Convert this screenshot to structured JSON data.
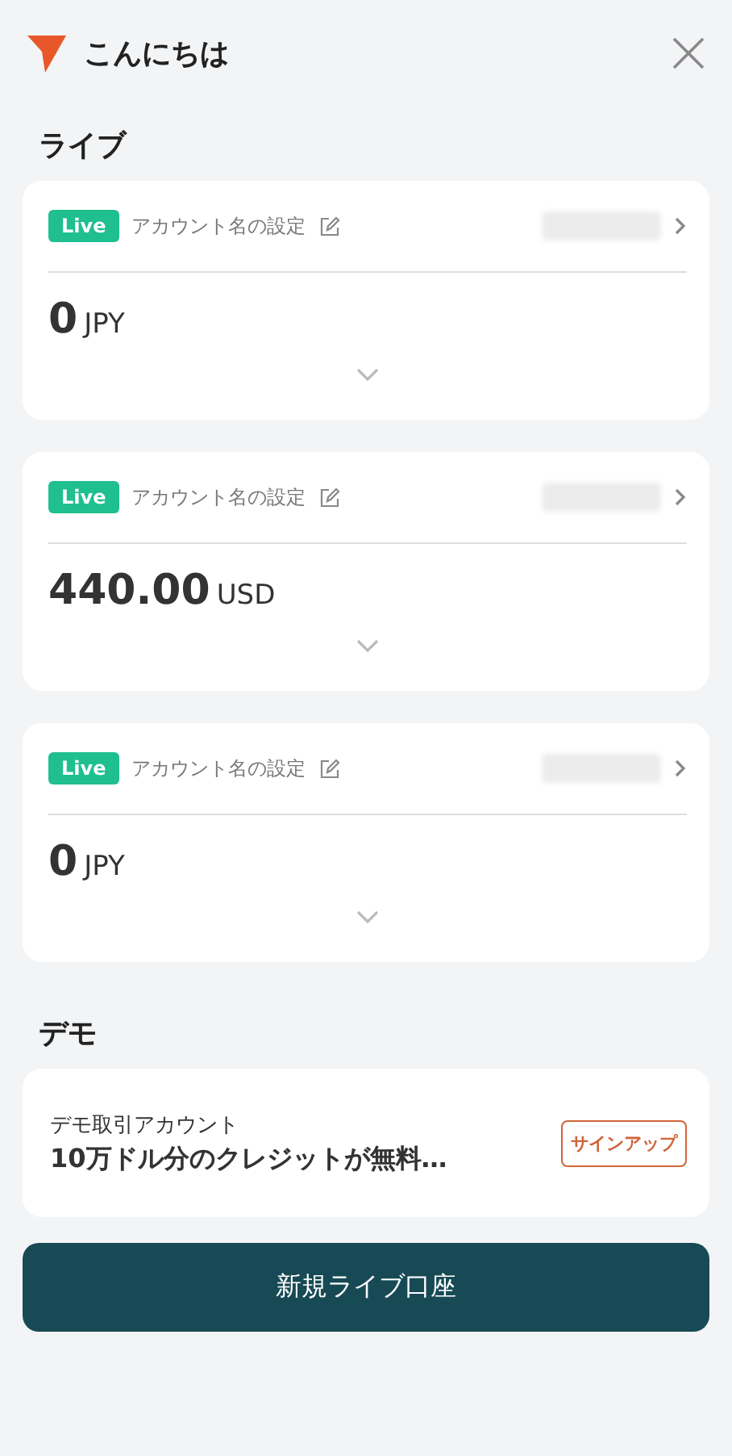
{
  "header": {
    "greeting": "こんにちは"
  },
  "live_section": {
    "title": "ライブ",
    "accounts": [
      {
        "badge": "Live",
        "name_label": "アカウント名の設定",
        "amount": "0",
        "currency": "JPY"
      },
      {
        "badge": "Live",
        "name_label": "アカウント名の設定",
        "amount": "440.00",
        "currency": "USD"
      },
      {
        "badge": "Live",
        "name_label": "アカウント名の設定",
        "amount": "0",
        "currency": "JPY"
      }
    ]
  },
  "demo_section": {
    "title": "デモ",
    "card": {
      "title": "デモ取引アカウント",
      "description": "10万ドル分のクレジットが無料…",
      "button": "サインアップ"
    }
  },
  "primary_button": "新規ライブ口座"
}
